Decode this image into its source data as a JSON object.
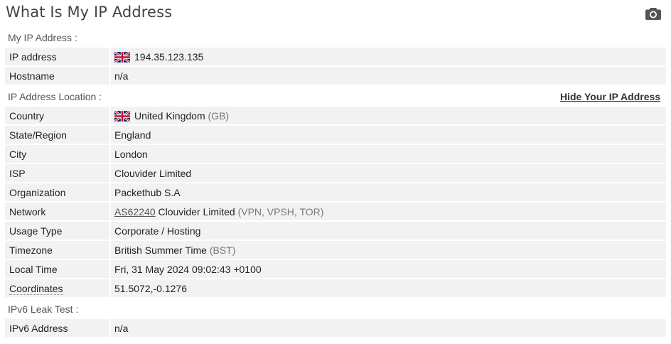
{
  "page": {
    "title": "What Is My IP Address"
  },
  "sections": {
    "my_ip": "My IP Address :",
    "location": "IP Address Location :",
    "ipv6": "IPv6 Leak Test :"
  },
  "hide_ip_link": "Hide Your IP Address",
  "icons": {
    "camera": "camera-icon",
    "flag": "uk-flag-icon"
  },
  "rows": {
    "ip_address": {
      "label": "IP address",
      "value": "194.35.123.135"
    },
    "hostname": {
      "label": "Hostname",
      "value": "n/a"
    },
    "country": {
      "label": "Country",
      "value": "United Kingdom",
      "extra": "(GB)"
    },
    "state": {
      "label": "State/Region",
      "value": "England"
    },
    "city": {
      "label": "City",
      "value": "London"
    },
    "isp": {
      "label": "ISP",
      "value": "Clouvider Limited"
    },
    "organization": {
      "label": "Organization",
      "value": "Packethub S.A"
    },
    "network": {
      "label": "Network",
      "asn": "AS62240",
      "value": "Clouvider Limited",
      "extra": "(VPN, VPSH, TOR)"
    },
    "usage_type": {
      "label": "Usage Type",
      "value": "Corporate / Hosting"
    },
    "timezone": {
      "label": "Timezone",
      "value": "British Summer Time",
      "extra": "(BST)"
    },
    "local_time": {
      "label": "Local Time",
      "value": "Fri, 31 May 2024 09:02:43 +0100"
    },
    "coordinates": {
      "label": "Coordinates",
      "value": "51.5072,-0.1276"
    },
    "ipv6_address": {
      "label": "IPv6 Address",
      "value": "n/a"
    }
  },
  "colors": {
    "row_bg": "#f2f2f2",
    "title": "#444444",
    "muted": "#777777"
  }
}
